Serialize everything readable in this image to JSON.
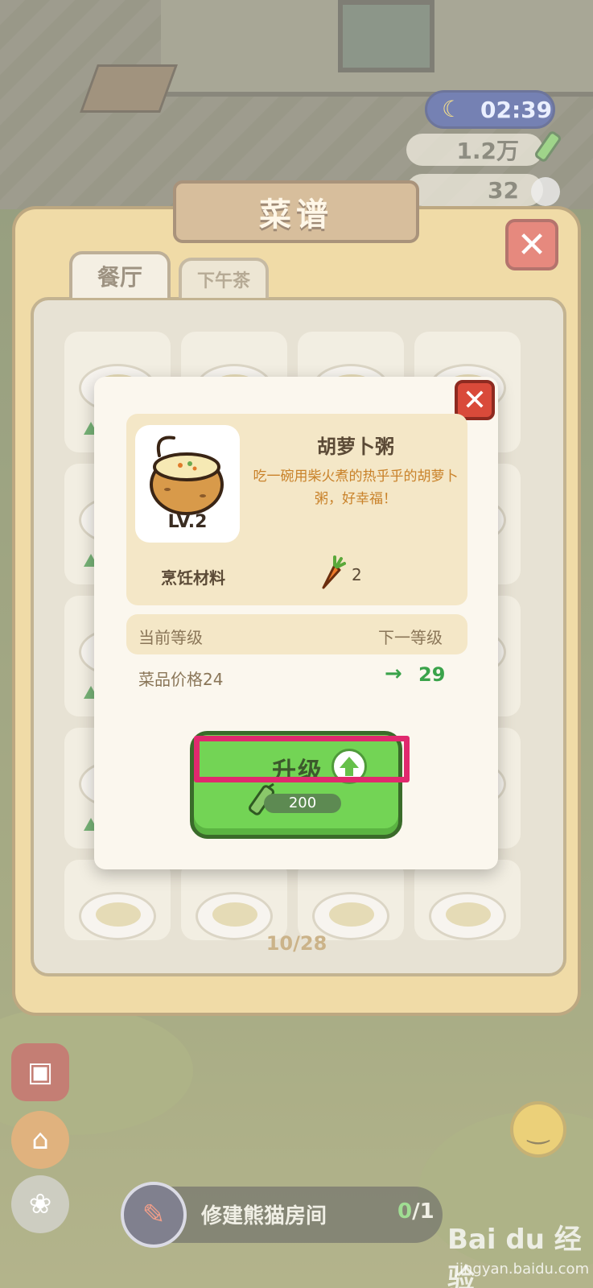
{
  "hud": {
    "time": "02:39",
    "coins": "1.2万",
    "gems": "32"
  },
  "book": {
    "title": "菜谱",
    "tabs": [
      {
        "label": "餐厅"
      },
      {
        "label": "下午茶"
      }
    ],
    "page": "10/28"
  },
  "modal": {
    "dish": {
      "name": "胡萝卜粥",
      "level": "LV.2",
      "description": "吃一碗用柴火煮的热乎乎的胡萝卜粥，好幸福！"
    },
    "materials": {
      "label": "烹饪材料",
      "icon": "carrot-icon",
      "count": "2"
    },
    "levels": {
      "current_label": "当前等级",
      "next_label": "下一等级"
    },
    "price": {
      "label": "菜品价格24",
      "next": "29"
    },
    "upgrade": {
      "label": "升级",
      "cost": "200"
    }
  },
  "task": {
    "label": "修建熊猫房间",
    "done": "0",
    "total": "/1"
  },
  "watermark": {
    "brand": "Bai du 经验",
    "url": "jingyan.baidu.com"
  },
  "colors": {
    "highlight": "#e0296e",
    "upgrade_green": "#73d455",
    "price_green": "#3aa34a",
    "close_red": "#d94a3a"
  }
}
